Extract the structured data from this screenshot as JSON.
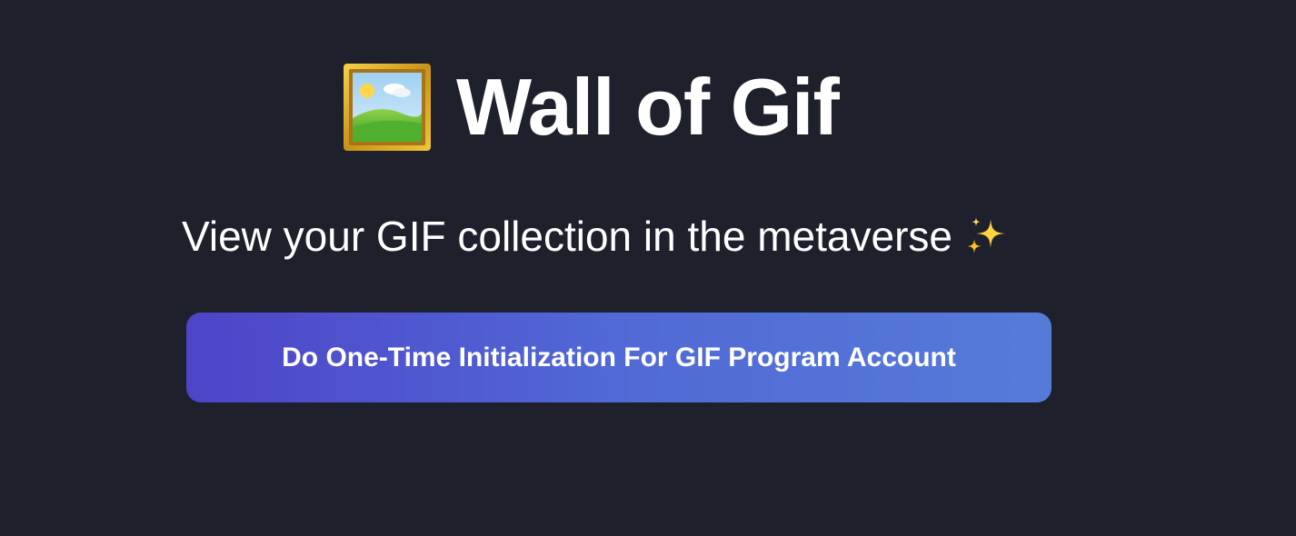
{
  "header": {
    "icon": "framed-picture-icon",
    "title": "Wall of Gif"
  },
  "subtitle": {
    "text": "View your GIF collection in the metaverse",
    "icon": "sparkles-icon"
  },
  "actions": {
    "init_label": "Do One-Time Initialization For GIF Program Account"
  },
  "colors": {
    "background": "#1e202c",
    "button_gradient_start": "#4e44c8",
    "button_gradient_end": "#557bd8",
    "text": "#ffffff"
  }
}
